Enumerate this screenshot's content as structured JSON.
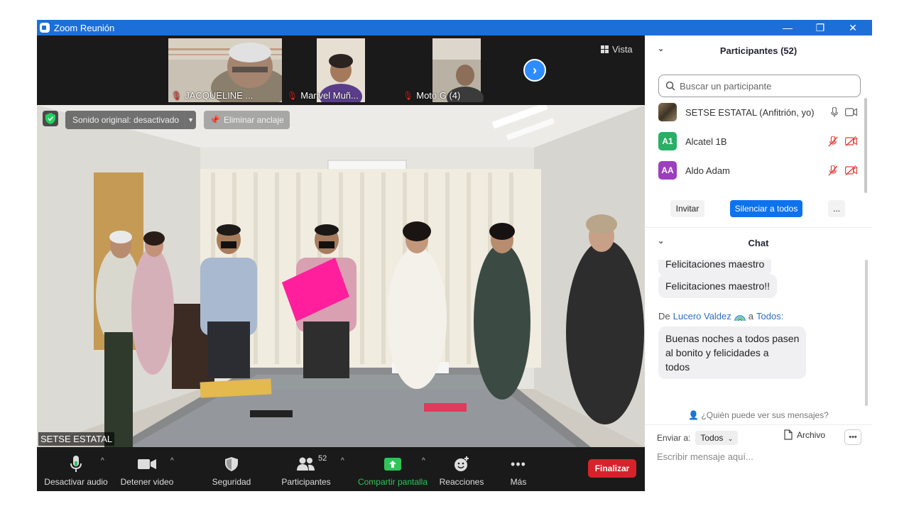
{
  "window": {
    "title": "Zoom Reunión",
    "minimize": "—",
    "restore": "❐",
    "close": "✕"
  },
  "thumbnails": [
    {
      "name": "JACQUELINE ...",
      "mic": "muted"
    },
    {
      "name": "Marivel Muñ...",
      "mic": "muted"
    },
    {
      "name": "Moto G (4)",
      "mic": "muted"
    }
  ],
  "next_page_icon": "chevron-right",
  "view_button": {
    "label": "Vista"
  },
  "video": {
    "speaker": "SETSE ESTATAL",
    "sound_label": "Sonido original: desactivado",
    "unpin_label": "Eliminar anclaje"
  },
  "toolbar": {
    "audio": "Desactivar audio",
    "video": "Detener video",
    "security": "Seguridad",
    "participants": "Participantes",
    "participant_count": "52",
    "share": "Compartir pantalla",
    "reactions": "Reacciones",
    "more": "Más",
    "end": "Finalizar"
  },
  "participants_panel": {
    "title": "Participantes (52)",
    "search_placeholder": "Buscar un participante",
    "list": [
      {
        "name": "SETSE ESTATAL (Anfitrión, yo)",
        "initials": "",
        "color": "#6b5a3c",
        "muted": false
      },
      {
        "name": "Alcatel 1B",
        "initials": "A1",
        "color": "#2bae66",
        "muted": true
      },
      {
        "name": "Aldo Adam",
        "initials": "AA",
        "color": "#9c3fbf",
        "muted": true
      }
    ],
    "invite": "Invitar",
    "mute_all": "Silenciar a todos",
    "more": "..."
  },
  "chat": {
    "title": "Chat",
    "partial_message": "Felicitaciones maestro",
    "messages": [
      {
        "text": "Felicitaciones maestro!!"
      }
    ],
    "from_prefix": "De",
    "sender": "Lucero Valdez",
    "to_word": "a",
    "recipient": "Todos:",
    "message2_line1": "Buenas noches a todos pasen",
    "message2_line2": "al bonito y felicidades a",
    "message2_line3": "todos",
    "who_can_see": "¿Quién puede ver sus mensajes?",
    "send_to_label": "Enviar a:",
    "send_to_value": "Todos",
    "file_label": "Archivo",
    "input_placeholder": "Escribir mensaje aquí..."
  },
  "colors": {
    "accent": "#2d8cff",
    "end": "#d7222c",
    "share": "#32c35a"
  }
}
